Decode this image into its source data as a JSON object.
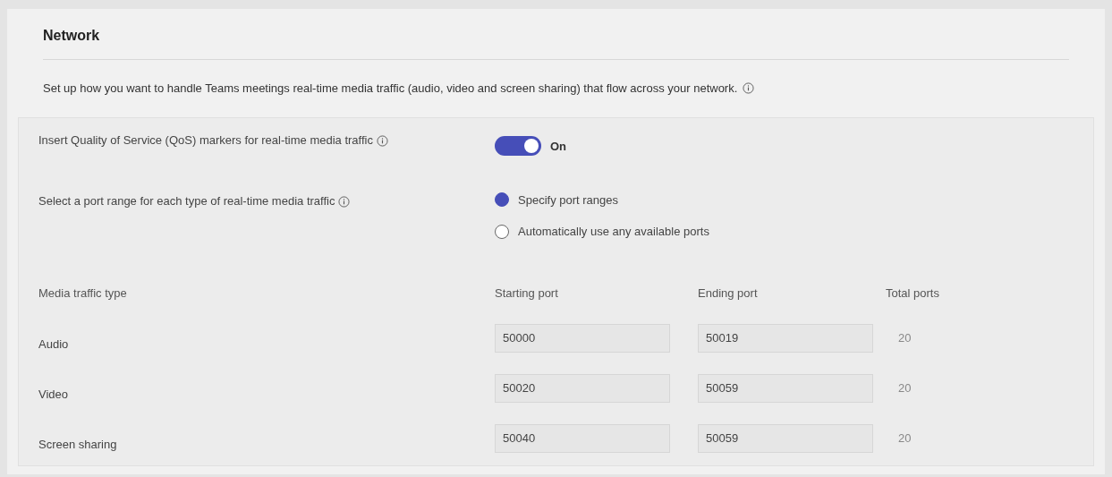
{
  "section": {
    "title": "Network",
    "description": "Set up how you want to handle Teams meetings real-time media traffic (audio, video and screen sharing) that flow across your network."
  },
  "qos": {
    "label": "Insert Quality of Service (QoS) markers for real-time media traffic",
    "on": true,
    "state_text": "On"
  },
  "port_range": {
    "label": "Select a port range for each type of real-time media traffic",
    "options": [
      {
        "label": "Specify port ranges",
        "selected": true
      },
      {
        "label": "Automatically use any available ports",
        "selected": false
      }
    ]
  },
  "table": {
    "columns": [
      "Media traffic type",
      "Starting port",
      "Ending port",
      "Total ports"
    ],
    "rows": [
      {
        "type": "Audio",
        "start": "50000",
        "end": "50019",
        "total": "20"
      },
      {
        "type": "Video",
        "start": "50020",
        "end": "50059",
        "total": "20"
      },
      {
        "type": "Screen sharing",
        "start": "50040",
        "end": "50059",
        "total": "20"
      }
    ]
  }
}
